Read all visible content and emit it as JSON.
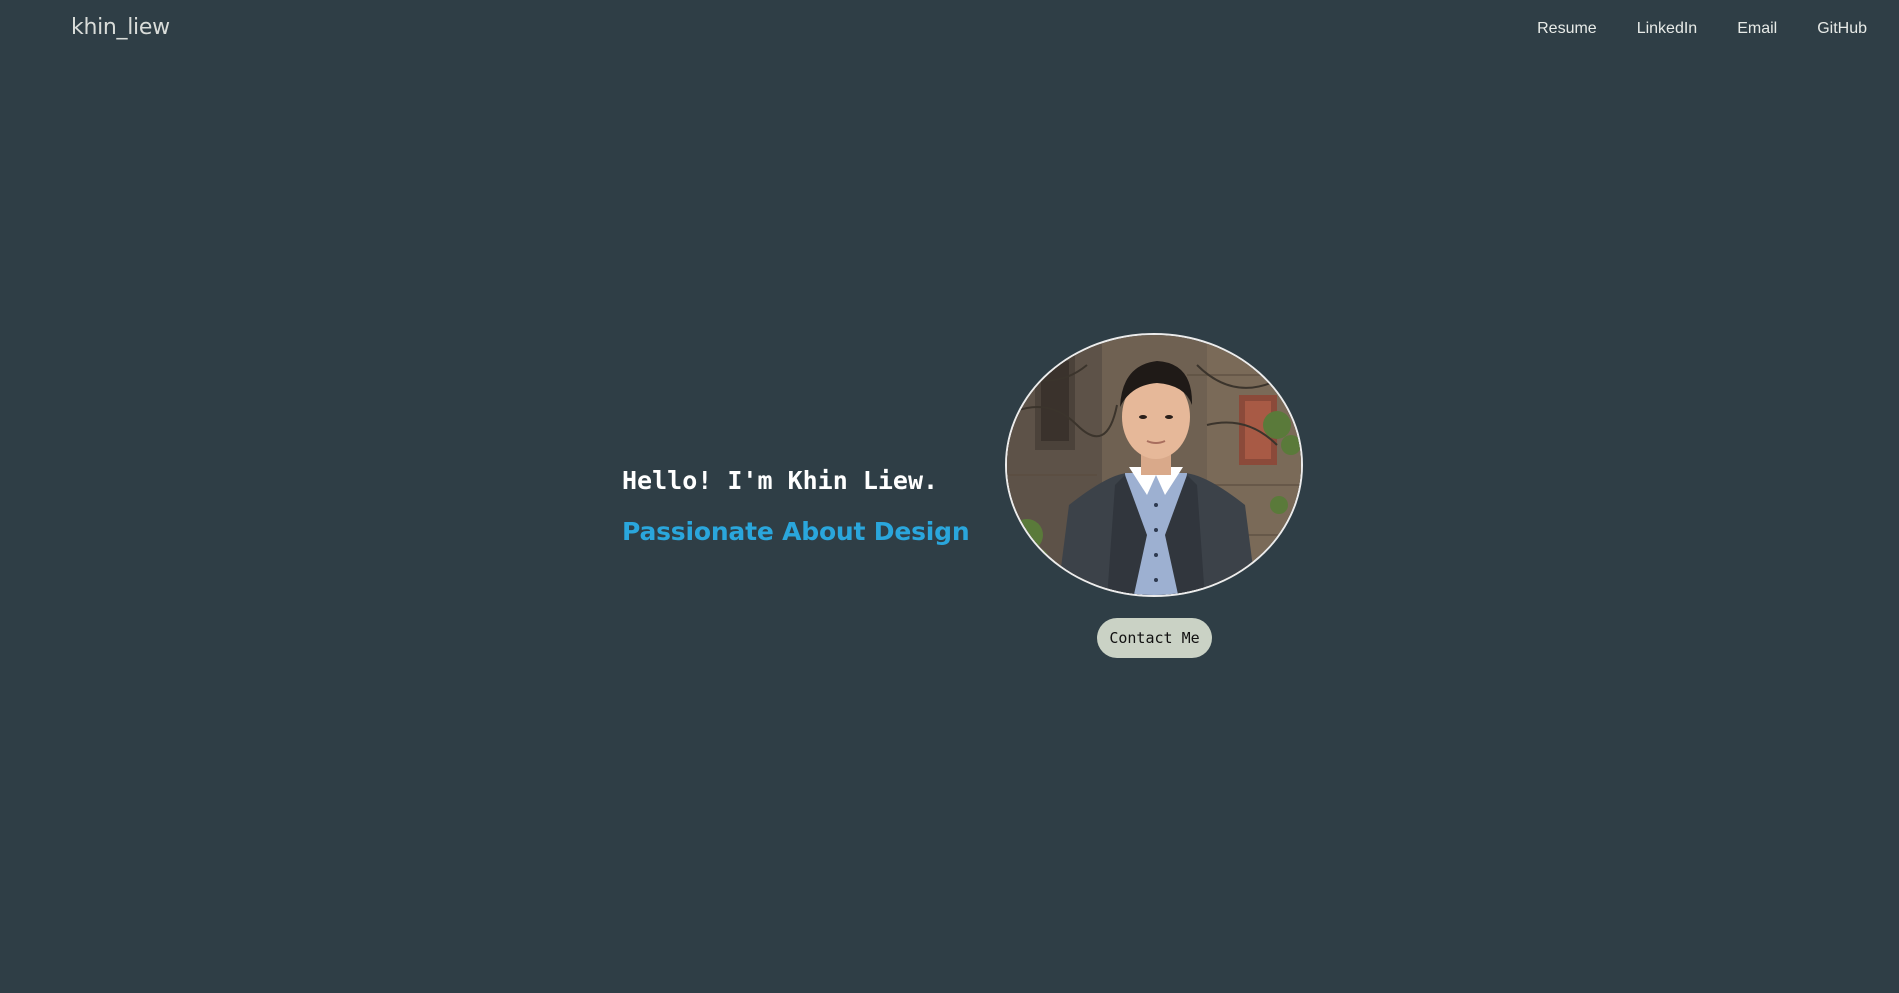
{
  "nav": {
    "brand": "khin_liew",
    "links": [
      "Resume",
      "LinkedIn",
      "Email",
      "GitHub"
    ]
  },
  "hero": {
    "greeting": "Hello! I'm Khin Liew.",
    "tagline": "Passionate About Design",
    "contact_label": "Contact Me",
    "portrait_icon": "profile-photo"
  },
  "colors": {
    "background": "#2f3e46",
    "accent": "#2aa6dc",
    "button": "#cad2c5"
  }
}
